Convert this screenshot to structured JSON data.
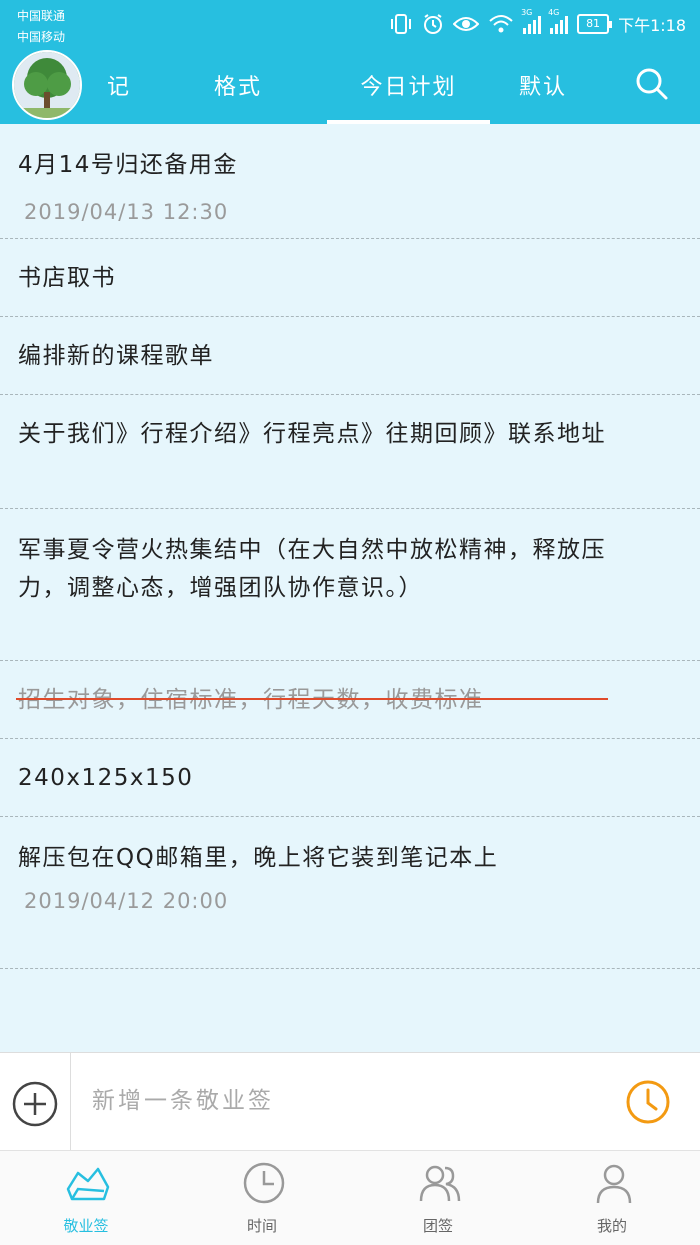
{
  "status_bar": {
    "carrier1": "中国联通",
    "carrier2": "中国移动",
    "net1": "3G",
    "net2": "4G",
    "battery": "81",
    "time": "下午1:18"
  },
  "header": {
    "tabs": [
      {
        "label": "记",
        "active": false
      },
      {
        "label": "格式",
        "active": false
      },
      {
        "label": "今日计划",
        "active": true
      },
      {
        "label": "默认",
        "active": false
      }
    ],
    "accent_color": "#27bfe0"
  },
  "notes": [
    {
      "text": "4月14号归还备用金",
      "date": "2019/04/13  12:30",
      "done": false
    },
    {
      "text": "书店取书",
      "date": "",
      "done": false
    },
    {
      "text": "编排新的课程歌单",
      "date": "",
      "done": false
    },
    {
      "text": "关于我们》行程介绍》行程亮点》往期回顾》联系地址",
      "date": "",
      "done": false
    },
    {
      "text": "军事夏令营火热集结中（在大自然中放松精神，释放压力，调整心态，增强团队协作意识。）",
      "date": "",
      "done": false
    },
    {
      "text": "招生对象，住宿标准，行程天数，收费标准",
      "date": "",
      "done": true
    },
    {
      "text": "240x125x150",
      "date": "",
      "done": false
    },
    {
      "text": "解压包在QQ邮箱里，晚上将它装到笔记本上",
      "date": "2019/04/12  20:00",
      "done": false
    }
  ],
  "composer": {
    "placeholder": "新增一条敬业签"
  },
  "bottom_nav": [
    {
      "label": "敬业签",
      "icon": "note-icon",
      "active": true
    },
    {
      "label": "时间",
      "icon": "clock-icon",
      "active": false
    },
    {
      "label": "团签",
      "icon": "team-icon",
      "active": false
    },
    {
      "label": "我的",
      "icon": "person-icon",
      "active": false
    }
  ]
}
